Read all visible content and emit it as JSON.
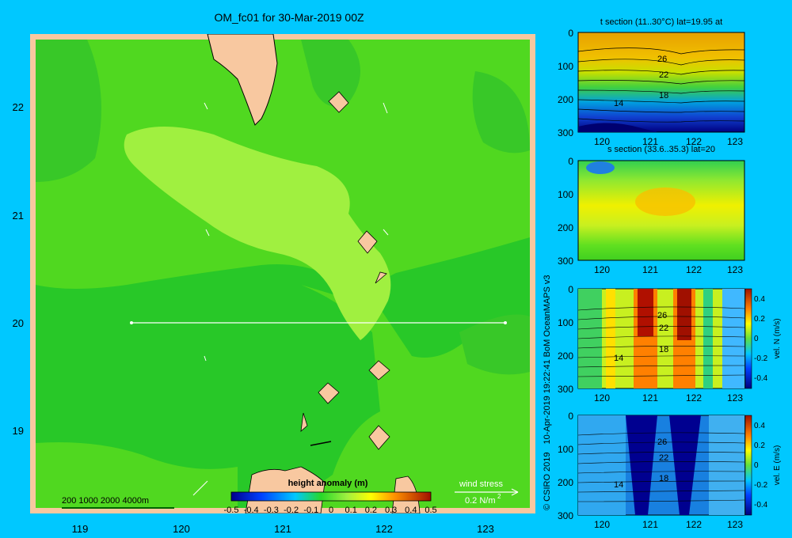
{
  "main_title": "OM_fc01 for 30-Mar-2019 00Z",
  "credit_line1": "© CSIRO 2019",
  "credit_line2": "10-Apr-2019 19:22:41 BoM OceanMAPS v3",
  "map": {
    "y_ticks": [
      "19",
      "20",
      "21",
      "22"
    ],
    "x_ticks": [
      "119",
      "120",
      "121",
      "122",
      "123"
    ],
    "depth_legend": "200  1000  2000  4000m",
    "colorbar_title": "height anomaly  (m)",
    "colorbar_ticks": [
      "-0.5",
      "-0.4",
      "-0.3",
      "-0.2",
      "-0.1",
      "0",
      "0.1",
      "0.2",
      "0.3",
      "0.4",
      "0.5"
    ],
    "wind_label": "wind stress",
    "wind_unit": "0.2 N/m",
    "wind_unit_sup": "2",
    "section_line": {
      "lat": 20,
      "lon_start": 119.5,
      "lon_end": 123.2
    }
  },
  "panels": [
    {
      "title": "t section (11..30°C) lat=19.95 at",
      "contours": [
        "26",
        "22",
        "18",
        "14"
      ]
    },
    {
      "title": "s section (33.6..35.3) lat=20",
      "contours": []
    },
    {
      "title": "",
      "contours": [
        "26",
        "22",
        "18",
        "14"
      ],
      "cbar_label": "vel. N  (m/s)"
    },
    {
      "title": "",
      "contours": [
        "26",
        "22",
        "18",
        "14"
      ],
      "cbar_label": "vel. E  (m/s)"
    }
  ],
  "panel_y_ticks": [
    "0",
    "100",
    "200",
    "300"
  ],
  "panel_x_ticks": [
    "120",
    "121",
    "122",
    "123"
  ],
  "vel_cbar_ticks": [
    "0.4",
    "0.2",
    "0",
    "-0.2",
    "-0.4"
  ],
  "chart_data": [
    {
      "type": "heatmap",
      "title": "OM_fc01 for 30-Mar-2019 00Z",
      "quantity": "height anomaly (m)",
      "colorbar_range": [
        -0.5,
        0.5
      ],
      "xlim": [
        118.5,
        123.5
      ],
      "ylim": [
        18.3,
        22.7
      ],
      "x_ticks": [
        119,
        120,
        121,
        122,
        123
      ],
      "y_ticks": [
        19,
        20,
        21,
        22
      ],
      "section_line": {
        "lat": 20,
        "lon": [
          119.5,
          123.2
        ]
      },
      "colors": {
        "land": "#f8c8a0",
        "low": "#28c828",
        "mid": "#50d820",
        "high": "#a0f040"
      }
    },
    {
      "type": "heatmap",
      "title": "t section (11..30°C) lat=19.95 at",
      "xlim": [
        119.6,
        123.3
      ],
      "ylim": [
        300,
        0
      ],
      "contour_labels": [
        26,
        22,
        18,
        14
      ]
    },
    {
      "type": "heatmap",
      "title": "s section (33.6..35.3) lat=20",
      "xlim": [
        119.6,
        123.3
      ],
      "ylim": [
        300,
        0
      ]
    },
    {
      "type": "heatmap",
      "title": "",
      "xlim": [
        119.6,
        123.3
      ],
      "ylim": [
        300,
        0
      ],
      "colorbar_label": "vel. N (m/s)",
      "colorbar_range": [
        -0.4,
        0.4
      ]
    },
    {
      "type": "heatmap",
      "title": "",
      "xlim": [
        119.6,
        123.3
      ],
      "ylim": [
        300,
        0
      ],
      "colorbar_label": "vel. E (m/s)",
      "colorbar_range": [
        -0.4,
        0.4
      ]
    }
  ]
}
